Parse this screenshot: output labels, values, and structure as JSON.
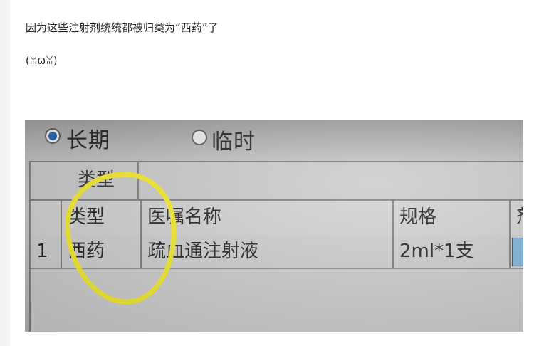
{
  "article": {
    "line1": "因为这些注射剂统统都被归类为“西药”了",
    "line2": "(ꈍωꈍ)"
  },
  "screen": {
    "radio_long": "长期",
    "radio_temp": "临时",
    "group_header": "类型",
    "columns": [
      "",
      "类型",
      "医嘱名称",
      "规格",
      "剂"
    ],
    "row": [
      "1",
      "西药",
      "疏血通注射液",
      "2ml*1支",
      ""
    ]
  },
  "colors": {
    "highlight_circle": "#f4ea2a",
    "radio_selected": "#1f5da8",
    "selected_cell": "#7fb2d6"
  }
}
